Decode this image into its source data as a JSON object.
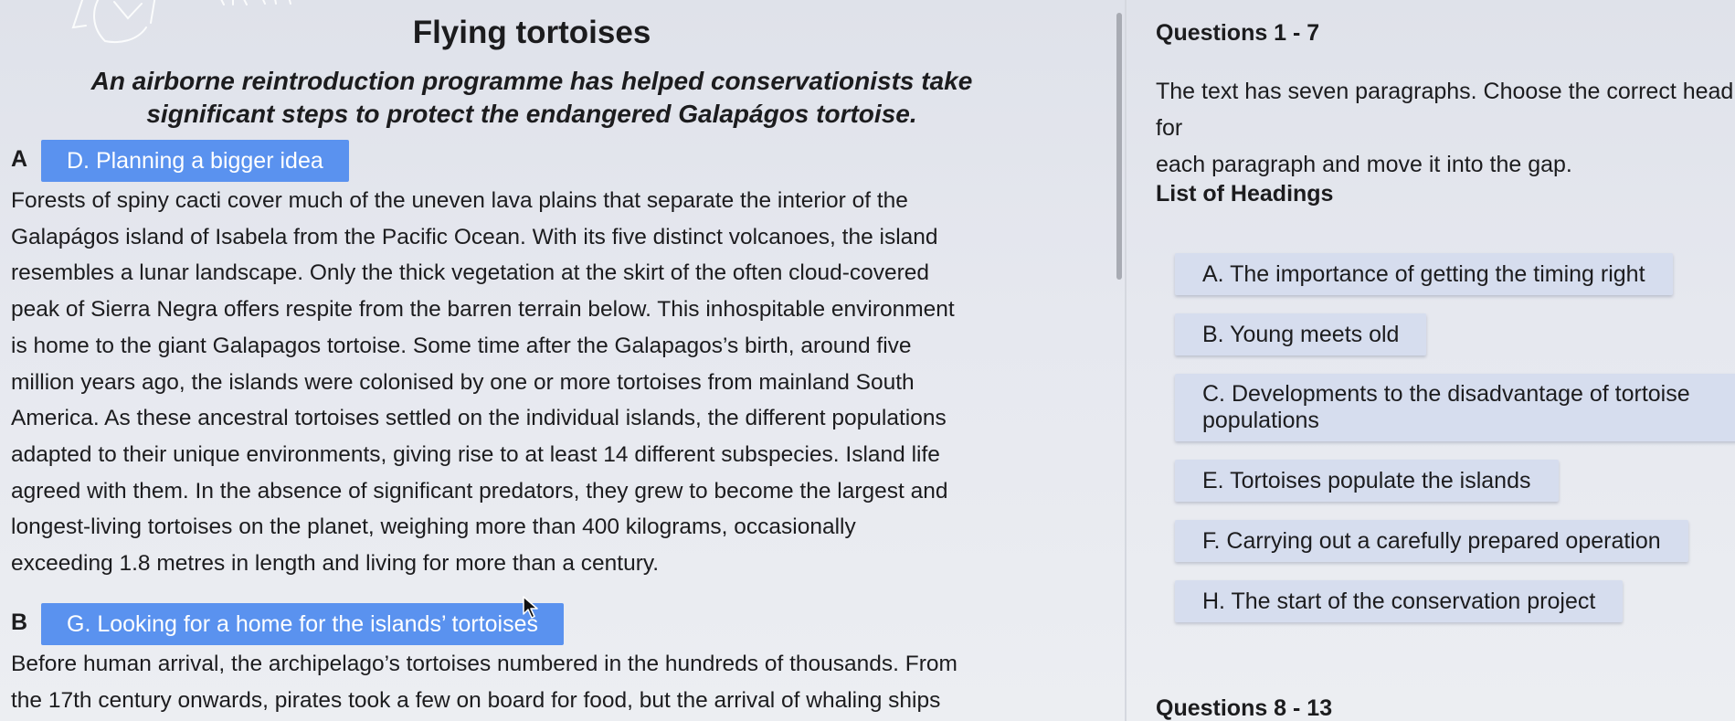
{
  "passage": {
    "title": "Flying tortoises",
    "subtitle": "An airborne reintroduction programme has helped conservationists take significant steps to protect the endangered Galapágos tortoise.",
    "paragraphs": [
      {
        "letter": "A",
        "assigned_heading": "D. Planning a bigger idea",
        "lines": [
          "Forests of spiny cacti cover much of the uneven lava plains that separate the interior of the",
          "Galapágos island of Isabela from the Pacific Ocean. With its five distinct volcanoes, the island",
          "resembles a lunar landscape. Only the thick vegetation at the skirt of the often cloud-covered",
          "peak of Sierra Negra offers respite from the barren terrain below. This inhospitable environment",
          "is home to the giant Galapagos tortoise. Some time after the Galapagos’s birth, around five",
          "million years ago, the islands were colonised by one or more tortoises from mainland South",
          "America. As these ancestral tortoises settled on the individual islands, the different populations",
          "adapted to their unique environments, giving rise to at least 14 different subspecies. Island life",
          "agreed with them. In the absence of significant predators, they grew to become the largest and",
          "longest-living tortoises on the planet, weighing more than 400 kilograms, occasionally",
          "exceeding 1.8 metres in length and living for more than a century."
        ]
      },
      {
        "letter": "B",
        "assigned_heading": "G. Looking for a home for the islands’ tortoises",
        "lines": [
          "Before human arrival, the archipelago’s tortoises numbered in the hundreds of thousands. From",
          "the 17th century onwards, pirates took a few on board for food, but the arrival of whaling ships"
        ]
      }
    ]
  },
  "questions": {
    "section1_title": "Questions 1 - 7",
    "instructions_line1": "The text has seven paragraphs. Choose the correct heading for",
    "instructions_line2": "each paragraph and move it into the gap.",
    "list_title": "List of Headings",
    "headings": [
      "A. The importance of getting the timing right",
      "B. Young meets old",
      "C. Developments to the disadvantage of tortoise populations",
      "E. Tortoises populate the islands",
      "F. Carrying out a carefully prepared operation",
      "H. The start of the conservation project"
    ],
    "section2_title": "Questions 8 - 13"
  },
  "colors": {
    "assigned_heading_bg": "#5a92ef",
    "heading_card_bg": "#d6ddee",
    "page_bg": "#e4e7ee"
  },
  "icons": {
    "cursor": "mouse-pointer-icon",
    "decoration": "sketch-doodle-icon"
  }
}
